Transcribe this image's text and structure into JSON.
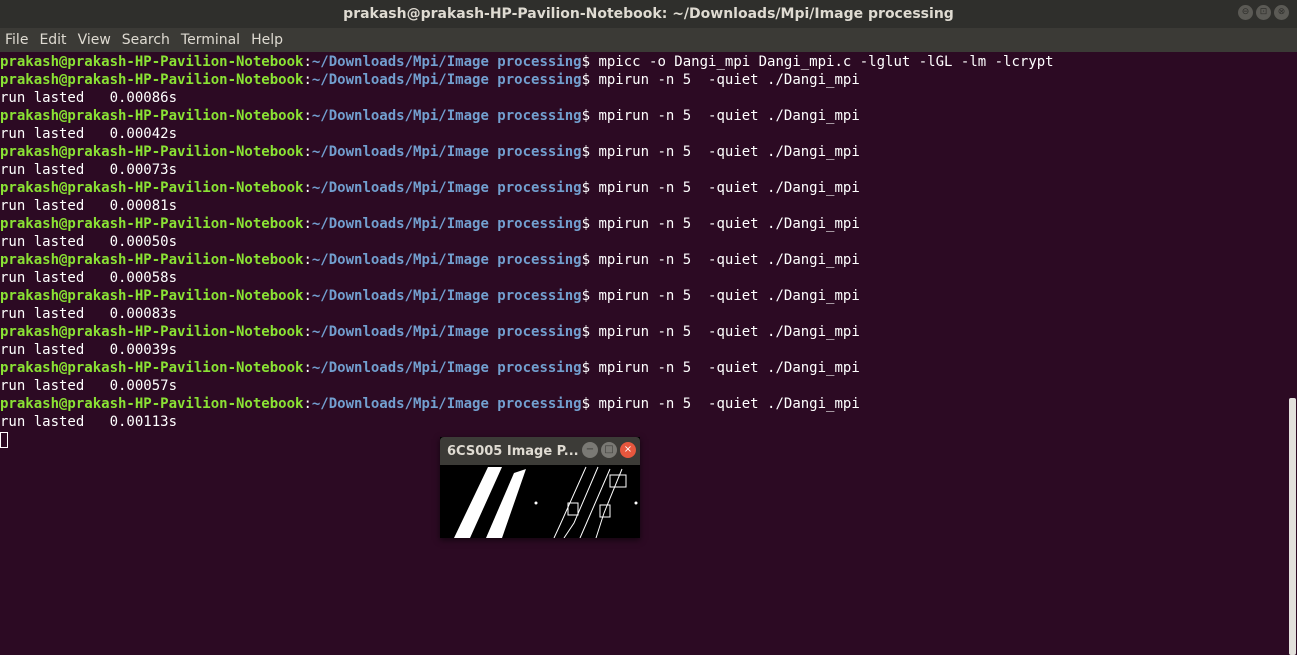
{
  "window": {
    "title": "prakash@prakash-HP-Pavilion-Notebook: ~/Downloads/Mpi/Image processing",
    "minimize_icon": "⊖",
    "maximize_icon": "⊡",
    "close_icon": "⊗"
  },
  "menu": {
    "file": "File",
    "edit": "Edit",
    "view": "View",
    "search": "Search",
    "terminal": "Terminal",
    "help": "Help"
  },
  "prompt": {
    "user": "prakash@prakash-HP-Pavilion-Notebook",
    "path": "~/Downloads/Mpi/Image processing",
    "colors": {
      "user": "#8ae234",
      "path": "#729fcf",
      "background": "#2c0a23"
    }
  },
  "terminal_lines": [
    {
      "type": "cmd",
      "command": "mpicc -o Dangi_mpi Dangi_mpi.c -lglut -lGL -lm -lcrypt"
    },
    {
      "type": "cmd",
      "command": "mpirun -n 5  -quiet ./Dangi_mpi"
    },
    {
      "type": "out",
      "text": "run lasted   0.00086s"
    },
    {
      "type": "cmd",
      "command": "mpirun -n 5  -quiet ./Dangi_mpi"
    },
    {
      "type": "out",
      "text": "run lasted   0.00042s"
    },
    {
      "type": "cmd",
      "command": "mpirun -n 5  -quiet ./Dangi_mpi"
    },
    {
      "type": "out",
      "text": "run lasted   0.00073s"
    },
    {
      "type": "cmd",
      "command": "mpirun -n 5  -quiet ./Dangi_mpi"
    },
    {
      "type": "out",
      "text": "run lasted   0.00081s"
    },
    {
      "type": "cmd",
      "command": "mpirun -n 5  -quiet ./Dangi_mpi"
    },
    {
      "type": "out",
      "text": "run lasted   0.00050s"
    },
    {
      "type": "cmd",
      "command": "mpirun -n 5  -quiet ./Dangi_mpi"
    },
    {
      "type": "out",
      "text": "run lasted   0.00058s"
    },
    {
      "type": "cmd",
      "command": "mpirun -n 5  -quiet ./Dangi_mpi"
    },
    {
      "type": "out",
      "text": "run lasted   0.00083s"
    },
    {
      "type": "cmd",
      "command": "mpirun -n 5  -quiet ./Dangi_mpi"
    },
    {
      "type": "out",
      "text": "run lasted   0.00039s"
    },
    {
      "type": "cmd",
      "command": "mpirun -n 5  -quiet ./Dangi_mpi"
    },
    {
      "type": "out",
      "text": "run lasted   0.00057s"
    },
    {
      "type": "cmd",
      "command": "mpirun -n 5  -quiet ./Dangi_mpi"
    },
    {
      "type": "out",
      "text": "run lasted   0.00113s"
    }
  ],
  "image_window": {
    "title": "6CS005 Image P...",
    "minimize_icon": "−",
    "maximize_icon": "□",
    "close_icon": "×"
  }
}
